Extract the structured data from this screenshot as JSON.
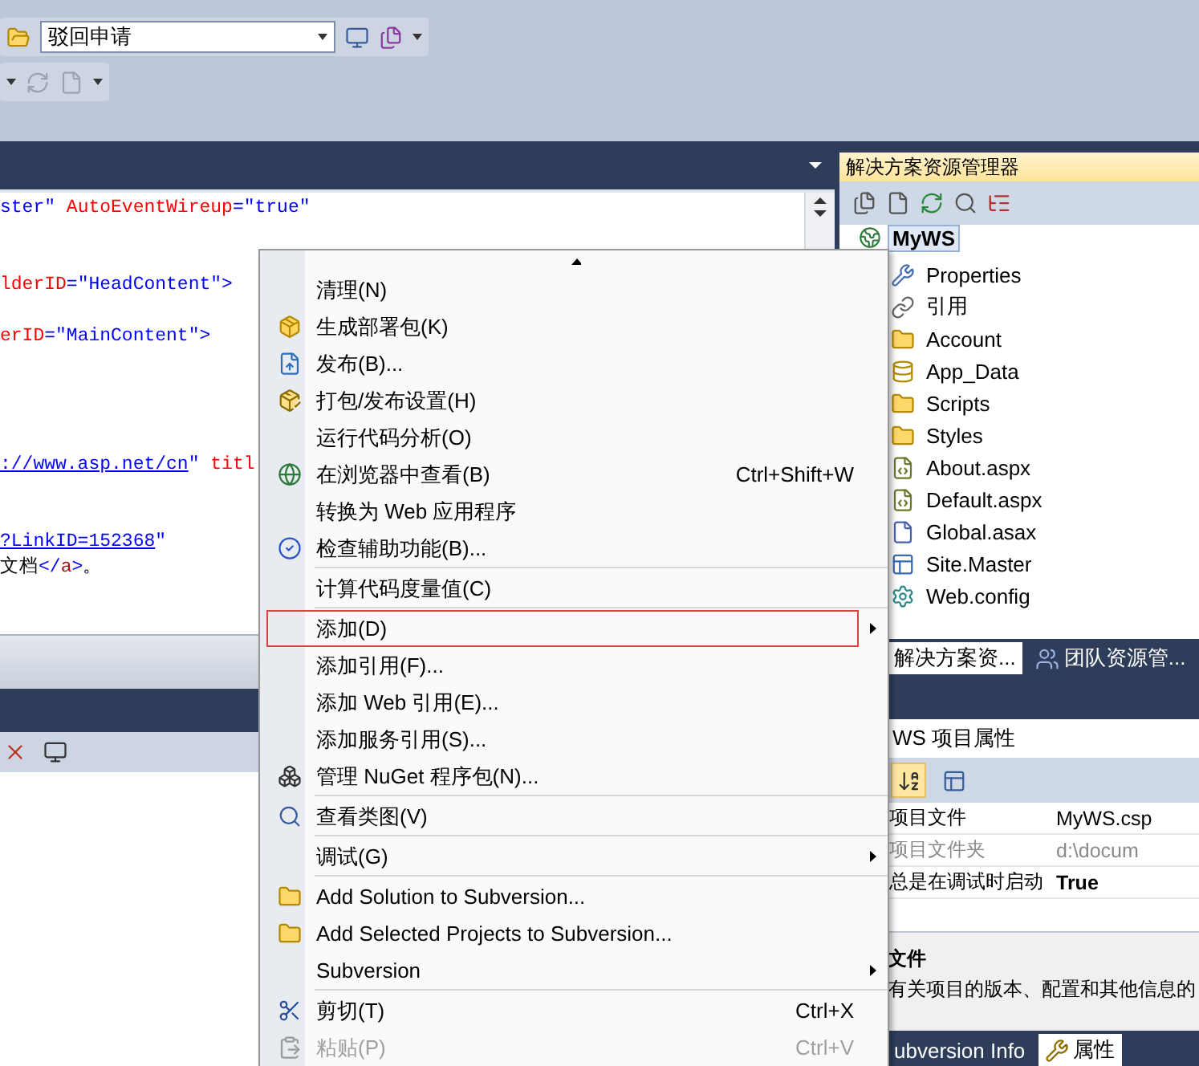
{
  "toolbar": {
    "combobox": {
      "value": "驳回申请"
    }
  },
  "editor": {
    "lines": [
      {
        "kind": "code",
        "segments": [
          {
            "kind": "string",
            "text": "ster\""
          },
          {
            "kind": "attr",
            "text": " AutoEventWireup"
          },
          {
            "kind": "string",
            "text": "=\"true\""
          }
        ]
      },
      {
        "kind": "blank"
      },
      {
        "kind": "blank"
      },
      {
        "kind": "code",
        "segments": [
          {
            "kind": "attr",
            "text": "lderID"
          },
          {
            "kind": "string",
            "text": "=\"HeadContent\">"
          }
        ]
      },
      {
        "kind": "blank"
      },
      {
        "kind": "code",
        "segments": [
          {
            "kind": "attr",
            "text": "erID"
          },
          {
            "kind": "string",
            "text": "=\"MainContent\">"
          }
        ]
      },
      {
        "kind": "blank"
      },
      {
        "kind": "blank"
      },
      {
        "kind": "blank"
      },
      {
        "kind": "blank"
      },
      {
        "kind": "code",
        "segments": [
          {
            "kind": "link",
            "text": "://www.asp.net/cn"
          },
          {
            "kind": "string",
            "text": "\""
          },
          {
            "kind": "attr",
            "text": " titl"
          }
        ]
      },
      {
        "kind": "blank"
      },
      {
        "kind": "blank"
      },
      {
        "kind": "code",
        "segments": [
          {
            "kind": "link",
            "text": "?LinkID=152368"
          },
          {
            "kind": "string",
            "text": "\""
          }
        ]
      },
      {
        "kind": "code",
        "segments": [
          {
            "kind": "text",
            "text": "文档"
          },
          {
            "kind": "string",
            "text": "</"
          },
          {
            "kind": "tag",
            "text": "a"
          },
          {
            "kind": "string",
            "text": ">"
          },
          {
            "kind": "text",
            "text": "。"
          }
        ]
      }
    ]
  },
  "context_menu": {
    "items": [
      {
        "kind": "item",
        "label": "清理(N)",
        "submenu": false,
        "disabled": false,
        "highlighted": false
      },
      {
        "kind": "item",
        "label": "生成部署包(K)",
        "submenu": false,
        "disabled": false,
        "highlighted": false
      },
      {
        "kind": "item",
        "label": "发布(B)...",
        "submenu": false,
        "disabled": false,
        "highlighted": false
      },
      {
        "kind": "item",
        "label": "打包/发布设置(H)",
        "submenu": false,
        "disabled": false,
        "highlighted": false
      },
      {
        "kind": "item",
        "label": "运行代码分析(O)",
        "submenu": false,
        "disabled": false,
        "highlighted": false
      },
      {
        "kind": "item",
        "label": "在浏览器中查看(B)",
        "shortcut": "Ctrl+Shift+W",
        "submenu": false,
        "disabled": false,
        "highlighted": false
      },
      {
        "kind": "item",
        "label": "转换为 Web 应用程序",
        "submenu": false,
        "disabled": false,
        "highlighted": false
      },
      {
        "kind": "item",
        "label": "检查辅助功能(B)...",
        "submenu": false,
        "disabled": false,
        "highlighted": false
      },
      {
        "kind": "separator"
      },
      {
        "kind": "item",
        "label": "计算代码度量值(C)",
        "submenu": false,
        "disabled": false,
        "highlighted": false
      },
      {
        "kind": "separator"
      },
      {
        "kind": "item",
        "label": "添加(D)",
        "submenu": true,
        "disabled": false,
        "highlighted": true
      },
      {
        "kind": "item",
        "label": "添加引用(F)...",
        "submenu": false,
        "disabled": false,
        "highlighted": false
      },
      {
        "kind": "item",
        "label": "添加 Web 引用(E)...",
        "submenu": false,
        "disabled": false,
        "highlighted": false
      },
      {
        "kind": "item",
        "label": "添加服务引用(S)...",
        "submenu": false,
        "disabled": false,
        "highlighted": false
      },
      {
        "kind": "item",
        "label": "管理 NuGet 程序包(N)...",
        "submenu": false,
        "disabled": false,
        "highlighted": false
      },
      {
        "kind": "separator"
      },
      {
        "kind": "item",
        "label": "查看类图(V)",
        "submenu": false,
        "disabled": false,
        "highlighted": false
      },
      {
        "kind": "separator"
      },
      {
        "kind": "item",
        "label": "调试(G)",
        "submenu": true,
        "disabled": false,
        "highlighted": false
      },
      {
        "kind": "separator"
      },
      {
        "kind": "item",
        "label": "Add Solution to Subversion...",
        "submenu": false,
        "disabled": false,
        "highlighted": false
      },
      {
        "kind": "item",
        "label": "Add Selected Projects to Subversion...",
        "submenu": false,
        "disabled": false,
        "highlighted": false
      },
      {
        "kind": "item",
        "label": "Subversion",
        "submenu": true,
        "disabled": false,
        "highlighted": false
      },
      {
        "kind": "separator"
      },
      {
        "kind": "item",
        "label": "剪切(T)",
        "shortcut": "Ctrl+X",
        "submenu": false,
        "disabled": false,
        "highlighted": false
      },
      {
        "kind": "item",
        "label": "粘贴(P)",
        "shortcut": "Ctrl+V",
        "submenu": false,
        "disabled": true,
        "highlighted": false
      }
    ]
  },
  "solution_explorer": {
    "title": "解决方案资源管理器",
    "tree": [
      {
        "label": "MyWS",
        "selected": true,
        "children": [
          {
            "label": "Properties",
            "selected": false
          },
          {
            "label": "引用",
            "selected": false
          },
          {
            "label": "Account",
            "selected": false
          },
          {
            "label": "App_Data",
            "selected": false
          },
          {
            "label": "Scripts",
            "selected": false
          },
          {
            "label": "Styles",
            "selected": false
          },
          {
            "label": "About.aspx",
            "selected": false
          },
          {
            "label": "Default.aspx",
            "selected": false
          },
          {
            "label": "Global.asax",
            "selected": false
          },
          {
            "label": "Site.Master",
            "selected": false
          },
          {
            "label": "Web.config",
            "selected": false
          }
        ]
      }
    ],
    "tabs": [
      {
        "label": "解决方案资...",
        "selected": true
      },
      {
        "label": "团队资源管...",
        "selected": false
      }
    ]
  },
  "properties": {
    "title": "WS 项目属性",
    "toolbar": [
      {
        "kind": "sort",
        "selected": true
      },
      {
        "kind": "pages",
        "selected": false
      }
    ],
    "rows": [
      {
        "name": "项目文件",
        "value": "MyWS.csp",
        "disabled": false,
        "non_default": false
      },
      {
        "name": "项目文件夹",
        "value": "d:\\docum",
        "disabled": true,
        "non_default": false
      },
      {
        "name": "总是在调试时启动",
        "value": "True",
        "disabled": false,
        "non_default": true
      }
    ],
    "description": {
      "title": "文件",
      "text": "有关项目的版本、配置和其他信息的"
    },
    "tabs": [
      {
        "label": "ubversion Info",
        "selected": false
      },
      {
        "label": "属性",
        "selected": true
      }
    ]
  }
}
